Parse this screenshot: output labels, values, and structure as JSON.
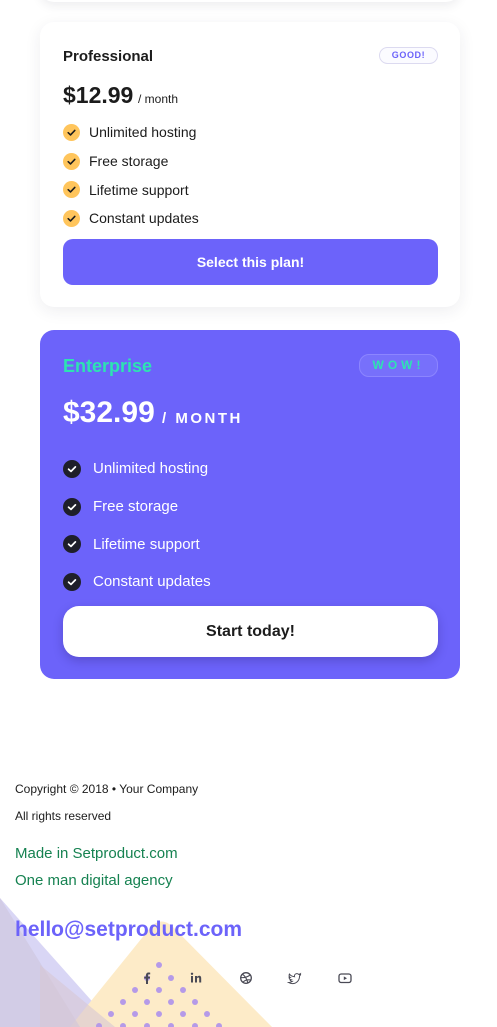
{
  "plans": {
    "professional": {
      "name": "Professional",
      "badge": "GOOD!",
      "price": "$12.99",
      "period": "/ month",
      "features": [
        "Unlimited hosting",
        "Free storage",
        "Lifetime support",
        "Constant updates"
      ],
      "cta_label": "Select this plan!"
    },
    "enterprise": {
      "name": "Enterprise",
      "badge": "WOW!",
      "price": "$32.99",
      "period": "/ MONTH",
      "features": [
        "Unlimited hosting",
        "Free storage",
        "Lifetime support",
        "Constant updates"
      ],
      "cta_label": "Start today!"
    }
  },
  "footer": {
    "copyright": "Copyright © 2018 • Your Company",
    "rights": "All rights reserved",
    "made_in": "Made in Setproduct.com",
    "agency": "One man digital agency",
    "email": "hello@setproduct.com",
    "social_icons": [
      "facebook-icon",
      "linkedin-icon",
      "dribbble-icon",
      "twitter-icon",
      "youtube-icon"
    ]
  },
  "colors": {
    "accent": "#6c63fa",
    "mint": "#2de3b2",
    "check_yellow": "#ffc55c",
    "green_text": "#168251"
  }
}
